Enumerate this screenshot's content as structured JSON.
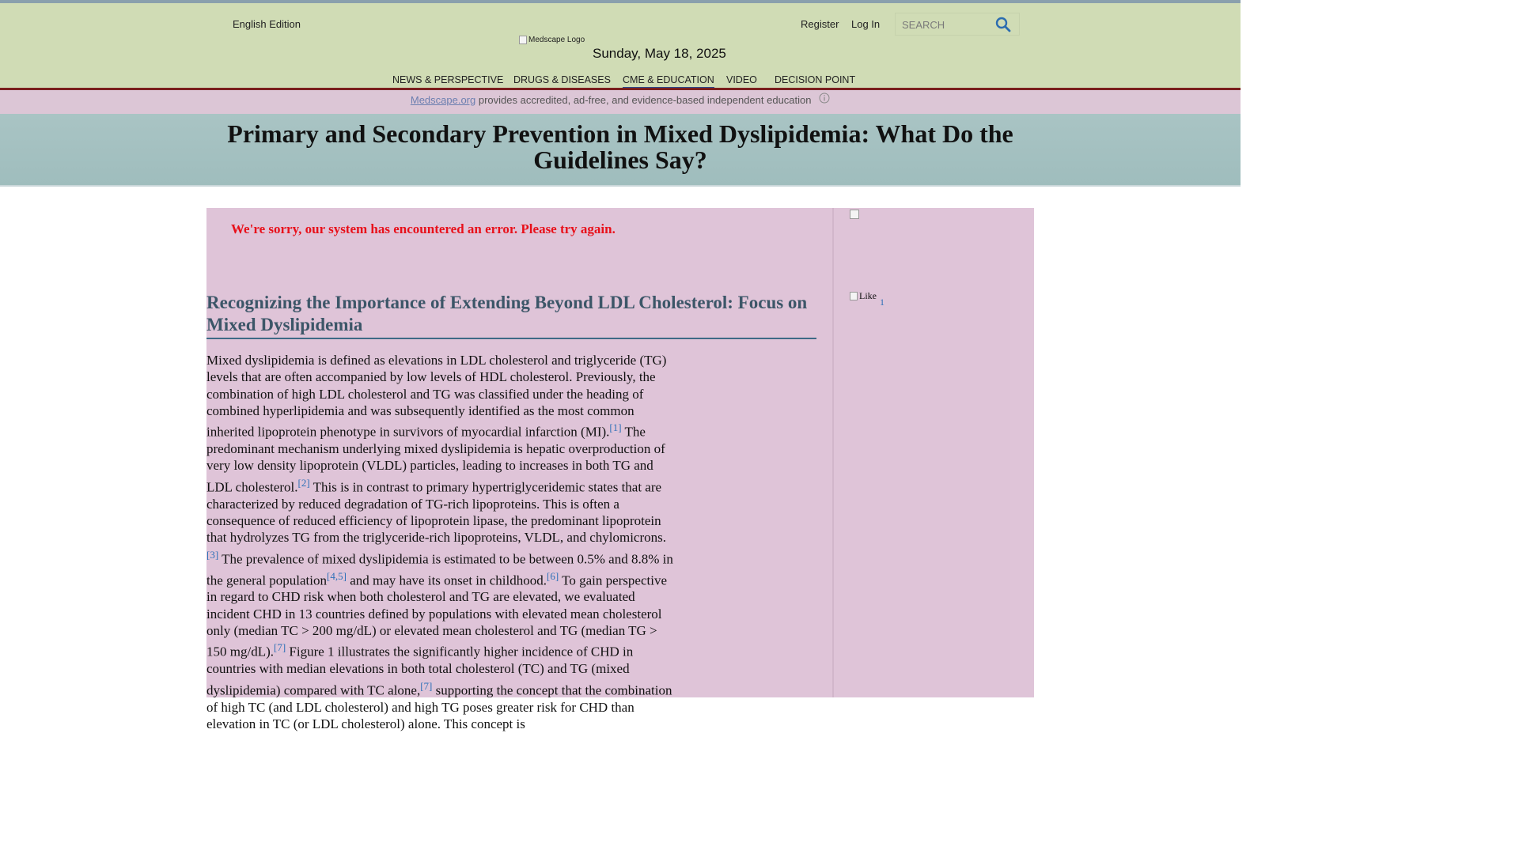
{
  "header": {
    "edition": "English Edition",
    "register": "Register",
    "login": "Log In",
    "search_placeholder": "SEARCH",
    "logo_alt": "Medscape Logo",
    "date": "Sunday, May 18, 2025"
  },
  "nav": {
    "items": [
      {
        "label": "NEWS & PERSPECTIVE",
        "active": false
      },
      {
        "label": "DRUGS & DISEASES",
        "active": false
      },
      {
        "label": "CME & EDUCATION",
        "active": true
      },
      {
        "label": "VIDEO",
        "active": false
      },
      {
        "label": "DECISION POINT",
        "active": false
      }
    ]
  },
  "banner": {
    "link": "Medscape.org",
    "text": " provides accredited, ad-free, and evidence-based independent education"
  },
  "title": "Primary and Secondary Prevention in Mixed Dyslipidemia: What Do the Guidelines Say?",
  "error": "We're sorry, our system has encountered an error. Please try again.",
  "section_heading": "Recognizing the Importance of Extending Beyond LDL Cholesterol: Focus on Mixed Dyslipidemia",
  "article": {
    "p1": "Mixed dyslipidemia is defined as elevations in LDL cholesterol and triglyceride (TG) levels that are often accompanied by low levels of HDL cholesterol. Previously, the combination of high LDL cholesterol and TG was classified under the heading of combined hyperlipidemia and was subsequently identified as the most common inherited lipoprotein phenotype in survivors of myocardial infarction (MI).",
    "r1": "[1]",
    "p2": " The predominant mechanism underlying mixed dyslipidemia is hepatic overproduction of very low density lipoprotein (VLDL) particles, leading to increases in both TG and LDL cholesterol.",
    "r2": "[2]",
    "p3": " This is in contrast to primary hypertriglyceridemic states that are characterized by reduced degradation of TG-rich lipoproteins. This is often a consequence of reduced efficiency of lipoprotein lipase, the predominant lipoprotein that hydrolyzes TG from the triglyceride-rich lipoproteins, VLDL, and chylomicrons.",
    "r3": "[3]",
    "p4": " The prevalence of mixed dyslipidemia is estimated to be between 0.5% and 8.8% in the general population",
    "r4": "[4,5]",
    "p5": " and may have its onset in childhood.",
    "r5": "[6]",
    "p6": " To gain perspective in regard to CHD risk when both cholesterol and TG are elevated, we evaluated incident CHD in 13 countries defined by populations with elevated mean cholesterol only (median TC > 200 mg/dL) or elevated mean cholesterol and TG (median TG > 150 mg/dL).",
    "r6": "[7]",
    "p7": " Figure 1 illustrates the significantly higher incidence of CHD in countries with median elevations in both total cholesterol (TC) and TG (mixed dyslipidemia) compared with TC alone,",
    "r7": "[7]",
    "p8": " supporting the concept that the combination of high TC (and LDL cholesterol) and high TG poses greater risk for CHD than elevation in TC (or LDL cholesterol) alone. This concept is"
  },
  "rail": {
    "like_alt": "Like",
    "like_count": "1"
  },
  "colors": {
    "header_bg": "#d0dcb5",
    "banner_bg": "#dcc6d6",
    "title_bg": "#a9c4c4",
    "content_bg": "#dfc4d8",
    "error": "#e8101a",
    "link": "#2d70b8",
    "nav_active": "#2b4a8a"
  },
  "icons": [
    "search-icon",
    "info-icon",
    "broken-image-icon"
  ]
}
